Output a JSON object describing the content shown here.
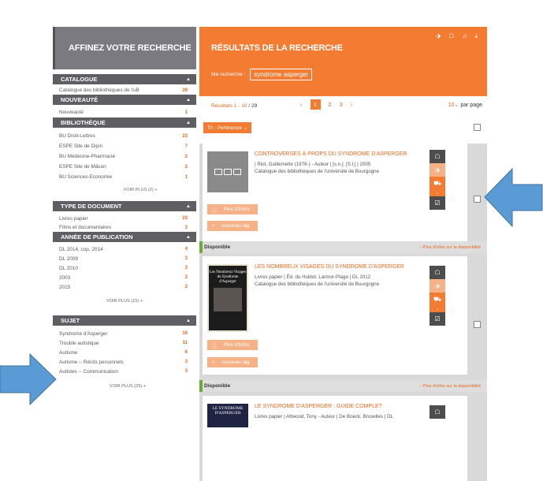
{
  "sidebar": {
    "header": "AFFINEZ VOTRE RECHERCHE",
    "sections": [
      {
        "title": "CATALOGUE",
        "items": [
          {
            "label": "Catalogue des bibliothèques de l'uB",
            "count": "29"
          }
        ]
      },
      {
        "title": "NOUVEAUTÉ",
        "items": [
          {
            "label": "Nouveauté",
            "count": "1"
          }
        ]
      },
      {
        "title": "BIBLIOTHÈQUE",
        "items": [
          {
            "label": "BU Droit-Lettres",
            "count": "23"
          },
          {
            "label": "ESPE Site de Dijon",
            "count": "7"
          },
          {
            "label": "BU Médecine-Pharmacie",
            "count": "2"
          },
          {
            "label": "ESPE Site de Mâcon",
            "count": "2"
          },
          {
            "label": "BU Sciences-Economie",
            "count": "1"
          }
        ],
        "more": "VOIR PLUS (2) +"
      },
      {
        "title": "TYPE DE DOCUMENT",
        "items": [
          {
            "label": "Livres papier",
            "count": "23"
          },
          {
            "label": "Films et documentaires",
            "count": "3"
          }
        ]
      },
      {
        "title": "ANNÉE DE PUBLICATION",
        "items": [
          {
            "label": "DL 2014, cop. 2014",
            "count": "4"
          },
          {
            "label": "DL 2009",
            "count": "3"
          },
          {
            "label": "DL 2010",
            "count": "3"
          },
          {
            "label": "2003",
            "count": "2"
          },
          {
            "label": "2015",
            "count": "2"
          }
        ],
        "more": "VOIR PLUS (15) +"
      },
      {
        "title": "SUJET",
        "items": [
          {
            "label": "Syndrome d'Asperger",
            "count": "19"
          },
          {
            "label": "Trouble autistique",
            "count": "11"
          },
          {
            "label": "Autisme",
            "count": "6"
          },
          {
            "label": "Autisme -- Récits personnels",
            "count": "3"
          },
          {
            "label": "Autistes -- Communication",
            "count": "3"
          }
        ],
        "more": "VOIR PLUS (25) +"
      }
    ]
  },
  "main": {
    "title": "RÉSULTATS DE LA RECHERCHE",
    "search_label": "Ma recherche :",
    "search_value": "syndrome asperger",
    "results_prefix": "Résultats 1 - 10",
    "results_total": " / 29",
    "pager": {
      "prev": "‹",
      "pages": [
        "1",
        "2",
        "3"
      ],
      "next": "›"
    },
    "perpage_num": "10",
    "perpage_label": "par page",
    "sort_label": "Tri : Pertinence",
    "results": [
      {
        "title": "CONTROVERSES À PROPS DU SYNDROME D'ASPERGER",
        "meta1": "| Riot, Guillemette (1976-) - Auteur | [s.n.]. [S.l.] | 2005",
        "meta2": "Catalogue des bibliothèques de l'université de Bourgogne",
        "info_btn": "Plus d'infos",
        "tag_btn": "nouveau tag",
        "dispo": "Disponible",
        "dispo_link": "› Plus d'infos sur la disponibilité"
      },
      {
        "title": "LES NOMBREUX VISAGES DU SYNDROME D'ASPERGER",
        "meta1": "Livres papier | Éd. du Hublot. Larmor-Plage | DL 2012",
        "meta2": "Catalogue des bibliothèques de l'université de Bourgogne",
        "cover_text": "Les Nombreux Visages du Syndrome d'Asperger",
        "info_btn": "Plus d'infos",
        "tag_btn": "nouveau tag",
        "dispo": "Disponible",
        "dispo_link": "› Plus d'infos sur la disponibilité"
      },
      {
        "title": "LE SYNDROME D'ASPERGER : GUIDE COMPLET",
        "meta1": "Livres papier | Attwood, Tony - Auteur | De Boeck. Bruxelles | DL",
        "cover_text": "LE SYNDROME D'ASPERGER"
      }
    ]
  },
  "colors": {
    "accent": "#f47c32",
    "sidebar_header": "#7b7a80",
    "section_bar": "#5f5e63",
    "arrow": "#5b9bd5",
    "available": "#6bab3a"
  },
  "icons": [
    "tag-icon",
    "comment-icon",
    "bell-icon",
    "download-icon",
    "cart-icon",
    "check-icon"
  ]
}
